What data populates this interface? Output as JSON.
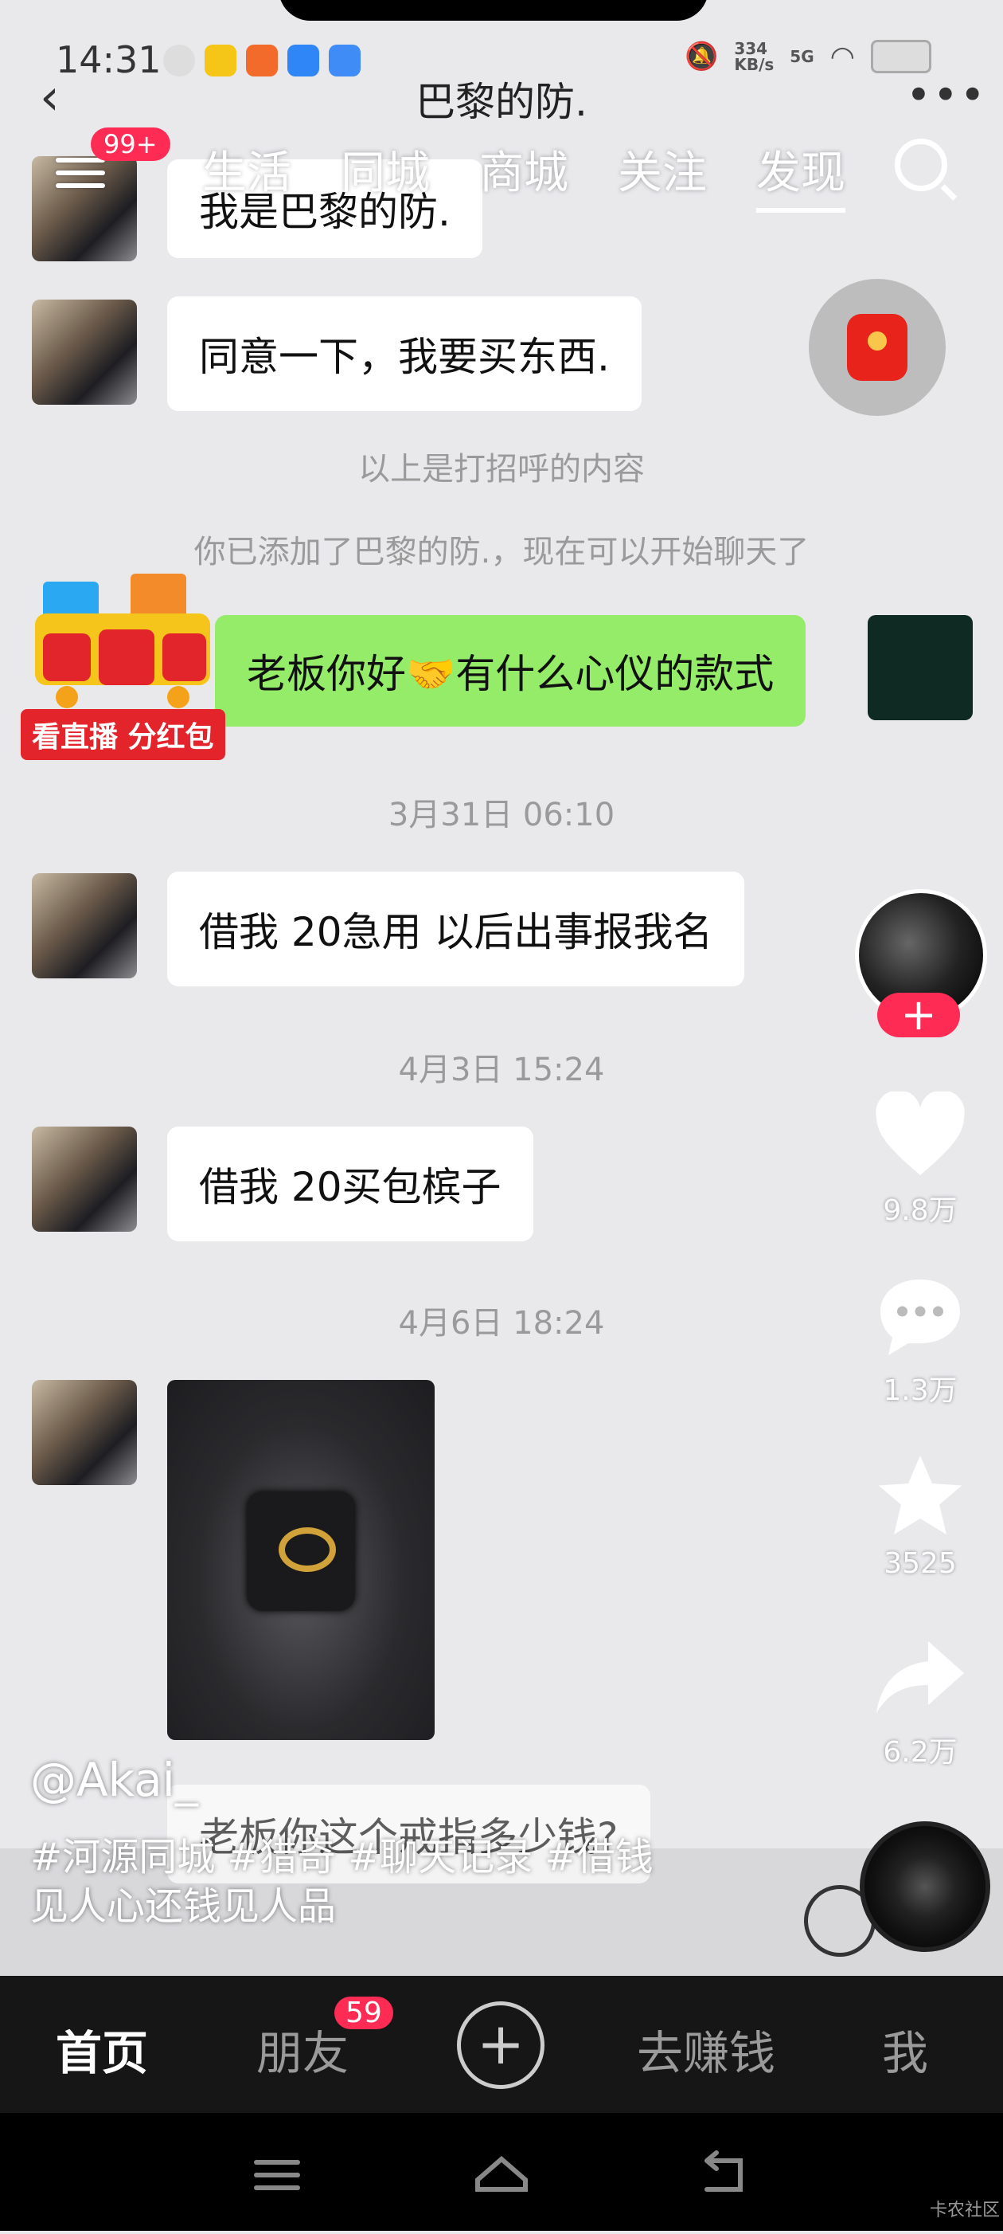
{
  "status_bar": {
    "time": "14:31",
    "net_speed": "334\nKB/s",
    "network": "5G"
  },
  "chat": {
    "title": "巴黎的防.",
    "messages": [
      {
        "text": "我是巴黎的防.",
        "side": "left"
      },
      {
        "text": "同意一下，我要买东西.",
        "side": "left"
      },
      {
        "text": "老板你好🤝有什么心仪的款式",
        "side": "right"
      },
      {
        "text": "借我 20急用 以后出事报我名",
        "side": "left"
      },
      {
        "text": "借我 20买包槟子",
        "side": "left"
      },
      {
        "text": "老板你这个戒指多少钱?",
        "side": "left"
      }
    ],
    "system_notes": {
      "greeting": "以上是打招呼的内容",
      "added": "你已添加了巴黎的防.，现在可以开始聊天了",
      "date1": "3月31日 06:10",
      "date2": "4月3日 15:24",
      "date3": "4月6日 18:24"
    }
  },
  "top_nav": {
    "menu_badge": "99+",
    "tabs": [
      "生活",
      "同城",
      "商城",
      "关注",
      "发现"
    ],
    "active_tab": "发现"
  },
  "promo": {
    "label": "看直播 分红包"
  },
  "actions": {
    "likes": "9.8万",
    "comments": "1.3万",
    "favorites": "3525",
    "shares": "6.2万"
  },
  "caption": {
    "author": "@Akai_",
    "text": "#河源同城 #猎奇 #聊天记录 #借钱\n见人心还钱见人品"
  },
  "tabbar": {
    "home": "首页",
    "friends": "朋友",
    "friends_badge": "59",
    "plus": "+",
    "earn": "去赚钱",
    "me": "我"
  },
  "watermark": "卡农社区",
  "colors": {
    "accent": "#fe2c55",
    "bubble_green": "#95ec69"
  }
}
